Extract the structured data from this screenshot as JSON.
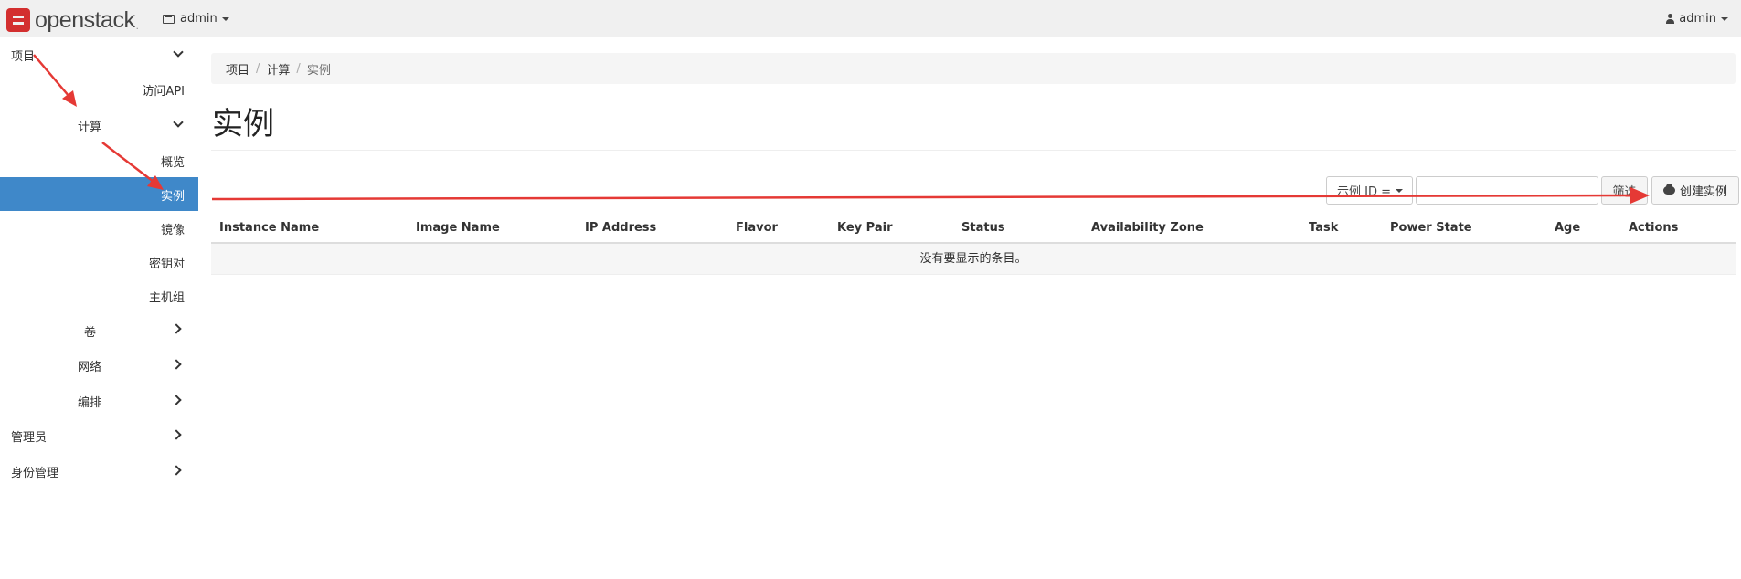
{
  "navbar": {
    "logo_text": "openstack",
    "logo_dot": ".",
    "project_name": "admin",
    "user_name": "admin"
  },
  "sidebar": {
    "project": "项目",
    "access_api": "访问API",
    "compute": "计算",
    "overview": "概览",
    "instances": "实例",
    "images": "镜像",
    "key_pairs": "密钥对",
    "server_groups": "主机组",
    "volumes": "卷",
    "network": "网络",
    "orchestration": "编排",
    "admin": "管理员",
    "identity": "身份管理"
  },
  "breadcrumb": {
    "items": [
      "项目",
      "计算",
      "实例"
    ],
    "separator": "/"
  },
  "page": {
    "title": "实例"
  },
  "toolbar": {
    "filter_field": "示例 ID =",
    "filter_input_value": "",
    "filter_button": "筛选",
    "create_button": "创建实例"
  },
  "table": {
    "columns": [
      "Instance Name",
      "Image Name",
      "IP Address",
      "Flavor",
      "Key Pair",
      "Status",
      "Availability Zone",
      "Task",
      "Power State",
      "Age",
      "Actions"
    ],
    "empty_text": "没有要显示的条目。"
  },
  "colors": {
    "active": "#3f88c9",
    "annotation": "#e53935",
    "logo": "#d32f2f"
  }
}
